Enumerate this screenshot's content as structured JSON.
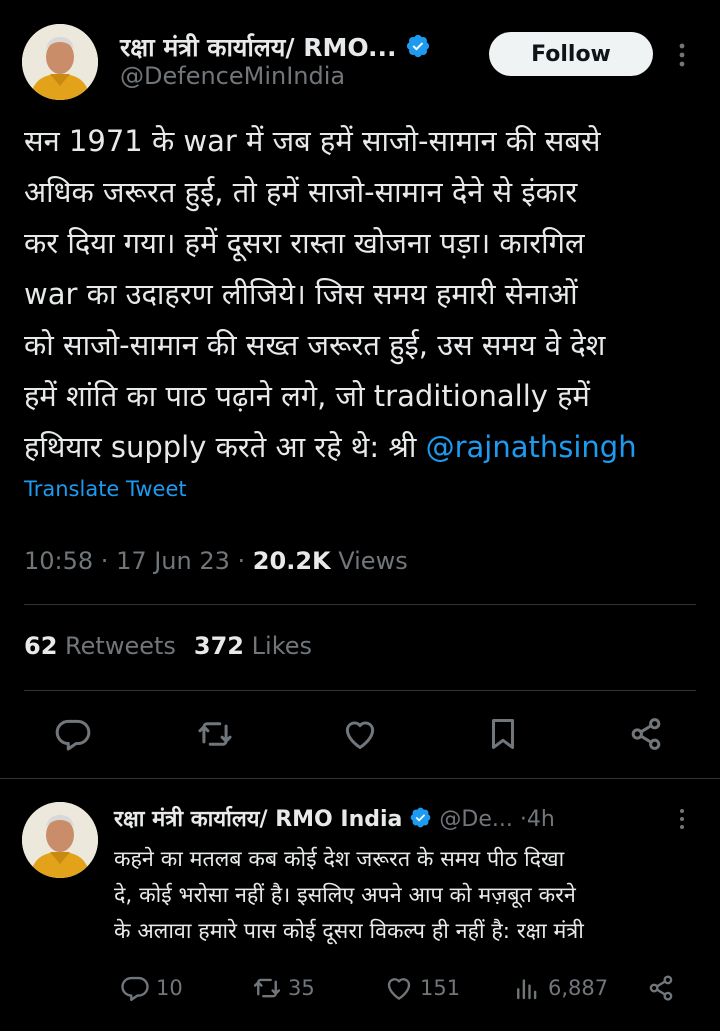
{
  "main_tweet": {
    "author_name": "रक्षा मंत्री कार्यालय/ RMO...",
    "handle": "@DefenceMinIndia",
    "follow_label": "Follow",
    "text_lines": [
      "सन 1971 के war में जब हमें साजो-सामान की सबसे",
      "अधिक जरूरत हुई, तो हमें साजो-सामान देने से इंकार",
      "कर दिया गया। हमें दूसरा रास्ता खोजना पड़ा। कारगिल",
      "war का उदाहरण लीजिये। जिस समय हमारी सेनाओं",
      "को साजो-सामान की सख्त जरूरत हुई, उस समय वे देश",
      "हमें शांति का पाठ पढ़ाने लगे, जो traditionally हमें"
    ],
    "last_line_text": "हथियार supply करते आ रहे थे: श्री ",
    "mention": "@rajnathsingh",
    "translate_label": "Translate Tweet",
    "time": "10:58",
    "date": "17 Jun 23",
    "views_count": "20.2K",
    "views_label": "Views",
    "retweets_count": "62",
    "retweets_label": "Retweets",
    "likes_count": "372",
    "likes_label": "Likes",
    "actions": [
      "reply-icon",
      "retweet-icon",
      "like-icon",
      "bookmark-icon",
      "share-icon"
    ]
  },
  "reply_tweet": {
    "author_name": "रक्षा मंत्री कार्यालय/ RMO India",
    "handle": "@De...",
    "dot": "·",
    "time": "4h",
    "text_lines": [
      "कहने का मतलब कब कोई देश जरूरत के समय पीठ दिखा",
      "दे, कोई भरोसा नहीं है। इसलिए अपने आप को मज़बूत करने",
      "के अलावा हमारे पास कोई दूसरा विकल्प ही नहीं है: रक्षा मंत्री"
    ],
    "reply_count": "10",
    "retweet_count": "35",
    "like_count": "151",
    "views_count": "6,887"
  },
  "colors": {
    "background": "#000000",
    "text": "#e7e9ea",
    "secondary": "#71767b",
    "accent": "#1d9bf0",
    "divider": "#2f3336"
  }
}
